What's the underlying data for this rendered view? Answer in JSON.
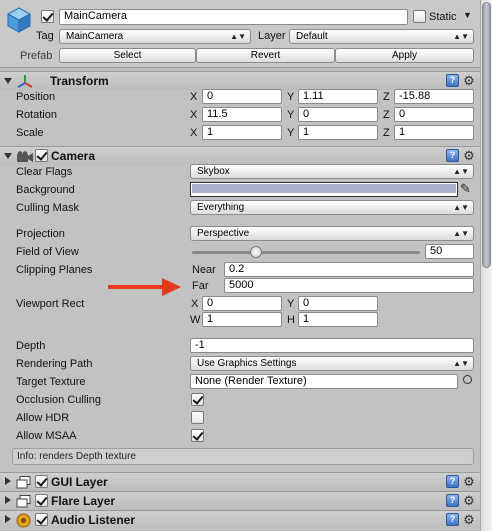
{
  "object": {
    "name": "MainCamera",
    "static_label": "Static",
    "tag_label": "Tag",
    "tag_value": "MainCamera",
    "layer_label": "Layer",
    "layer_value": "Default",
    "prefab_label": "Prefab",
    "prefab_buttons": [
      "Select",
      "Revert",
      "Apply"
    ]
  },
  "transform": {
    "title": "Transform",
    "rows": [
      {
        "label": "Position",
        "x": "0",
        "y": "1.11",
        "z": "-15.88"
      },
      {
        "label": "Rotation",
        "x": "11.5",
        "y": "0",
        "z": "0"
      },
      {
        "label": "Scale",
        "x": "1",
        "y": "1",
        "z": "1"
      }
    ],
    "axis": [
      "X",
      "Y",
      "Z"
    ]
  },
  "camera": {
    "title": "Camera",
    "clear_flags_label": "Clear Flags",
    "clear_flags_value": "Skybox",
    "background_label": "Background",
    "background_color": "#a9b0c9",
    "culling_mask_label": "Culling Mask",
    "culling_mask_value": "Everything",
    "projection_label": "Projection",
    "projection_value": "Perspective",
    "fov_label": "Field of View",
    "fov_value": "50",
    "fov_fraction": 0.28,
    "clipping_label": "Clipping Planes",
    "near_label": "Near",
    "near_value": "0.2",
    "far_label": "Far",
    "far_value": "5000",
    "viewport_label": "Viewport Rect",
    "viewport": {
      "x_label": "X",
      "x": "0",
      "y_label": "Y",
      "y": "0",
      "w_label": "W",
      "w": "1",
      "h_label": "H",
      "h": "1"
    },
    "depth_label": "Depth",
    "depth_value": "-1",
    "rendering_path_label": "Rendering Path",
    "rendering_path_value": "Use Graphics Settings",
    "target_texture_label": "Target Texture",
    "target_texture_value": "None (Render Texture)",
    "occlusion_label": "Occlusion Culling",
    "hdr_label": "Allow HDR",
    "msaa_label": "Allow MSAA",
    "info": "Info: renders Depth texture"
  },
  "components": [
    {
      "title": "GUI Layer"
    },
    {
      "title": "Flare Layer"
    },
    {
      "title": "Audio Listener"
    }
  ],
  "colors": {
    "arrow": "#e8381e",
    "help": "#3e73c4",
    "panel": "#c2c2c2"
  }
}
